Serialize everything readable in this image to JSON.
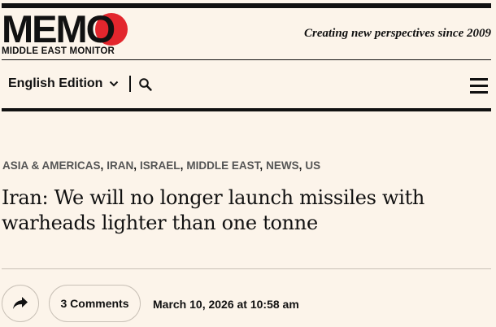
{
  "header": {
    "logo_letters": "MEMO",
    "logo_subtitle": "MIDDLE EAST MONITOR",
    "tagline": "Creating new perspectives since 2009",
    "accent_color": "#e3262d"
  },
  "nav": {
    "edition_label": "English Edition",
    "edition_icon": "chevron-down-icon",
    "search_icon": "search-icon",
    "menu_icon": "hamburger-menu-icon"
  },
  "article": {
    "categories": [
      "ASIA & AMERICAS",
      "IRAN",
      "ISRAEL",
      "MIDDLE EAST",
      "NEWS",
      "US"
    ],
    "category_separator": ",",
    "headline": "Iran: We will no longer launch missiles with warheads lighter than one tonne",
    "share_icon": "share-arrow-icon",
    "comments_label": "3 Comments",
    "date": "March 10, 2026 at 10:58 am"
  }
}
